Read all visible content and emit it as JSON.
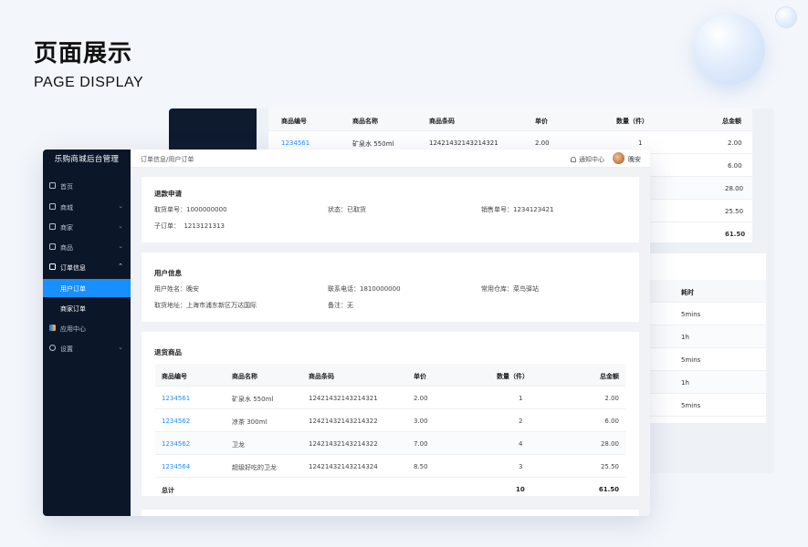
{
  "hero": {
    "title": "页面展示",
    "subtitle": "PAGE DISPLAY"
  },
  "back_table": {
    "headers": [
      "商品编号",
      "商品名称",
      "商品条码",
      "单价",
      "数量（件）",
      "总金额"
    ],
    "row1": [
      "1234561",
      "矿泉水 550ml",
      "12421432143214321",
      "2.00",
      "1",
      "2.00"
    ],
    "amounts": [
      "6.00",
      "28.00",
      "25.50",
      "61.50"
    ]
  },
  "back_log": {
    "header": "耗时",
    "values": [
      "5mins",
      "1h",
      "5mins",
      "1h",
      "5mins"
    ]
  },
  "app": {
    "title": "乐购商城后台管理",
    "menu": [
      {
        "label": "首页",
        "icon": "home-icon"
      },
      {
        "label": "商城",
        "icon": "cart-icon"
      },
      {
        "label": "商家",
        "icon": "store-icon"
      },
      {
        "label": "商品",
        "icon": "bag-icon"
      },
      {
        "label": "订单信息",
        "icon": "order-icon"
      },
      {
        "label": "用户订单"
      },
      {
        "label": "商家订单"
      },
      {
        "label": "应用中心",
        "icon": "apps-icon"
      },
      {
        "label": "设置",
        "icon": "gear-icon"
      }
    ],
    "breadcrumb": "订单信息/用户订单",
    "notice": "通知中心",
    "user": "晚安"
  },
  "refund": {
    "title": "退款申请",
    "order_no": "取货单号：1000000000",
    "status": "状态：已取货",
    "sale_no": "销售单号：1234123421",
    "sub_order": "子订单：  1213121313"
  },
  "user_info": {
    "title": "用户信息",
    "name": "用户姓名：晚安",
    "phone": "联系电话：1810000000",
    "warehouse": "常用仓库：菜鸟驿站",
    "address": "取货地址：上海市浦东新区万达国际",
    "remark": "备注：无"
  },
  "goods": {
    "title": "退货商品",
    "headers": [
      "商品编号",
      "商品名称",
      "商品条码",
      "单价",
      "数量（件）",
      "总金额"
    ],
    "rows": [
      [
        "1234561",
        "矿泉水  550ml",
        "12421432143214321",
        "2.00",
        "1",
        "2.00"
      ],
      [
        "1234562",
        "凉茶  300ml",
        "12421432143214322",
        "3.00",
        "2",
        "6.00"
      ],
      [
        "1234562",
        "卫龙",
        "12421432143214322",
        "7.00",
        "4",
        "28.00"
      ],
      [
        "1234564",
        "超级好吃的卫龙",
        "12421432143214324",
        "8.50",
        "3",
        "25.50"
      ]
    ],
    "total": [
      "总计",
      "10",
      "61.50"
    ]
  },
  "colors": {
    "sidebar": "#0b1628",
    "accent": "#1890ff",
    "link": "#1e8fff"
  }
}
